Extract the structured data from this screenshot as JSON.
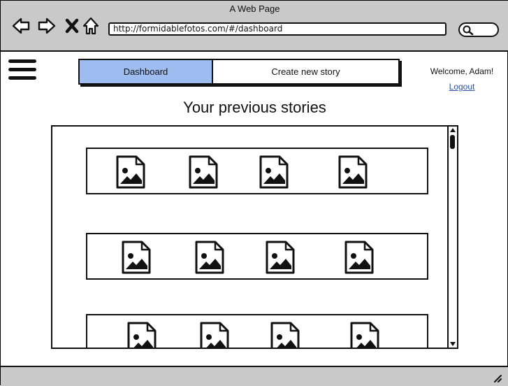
{
  "window": {
    "title": "A Web Page"
  },
  "browser": {
    "url": "http://formidablefotos.com/#/dashboard",
    "icons": [
      "back-arrow-icon",
      "forward-arrow-icon",
      "close-icon",
      "home-icon",
      "search-icon"
    ]
  },
  "nav": {
    "tabs": [
      {
        "label": "Dashboard",
        "active": true
      },
      {
        "label": "Create new story",
        "active": false
      }
    ]
  },
  "user": {
    "welcome": "Welcome, Adam!",
    "logout": "Logout"
  },
  "main": {
    "heading": "Your previous stories",
    "stories": [
      {
        "images": 4
      },
      {
        "images": 4
      },
      {
        "images": 4
      }
    ]
  },
  "colors": {
    "active_tab": "#9dbcf0",
    "chrome": "#c9c9c9",
    "link": "#2a4fb0"
  }
}
